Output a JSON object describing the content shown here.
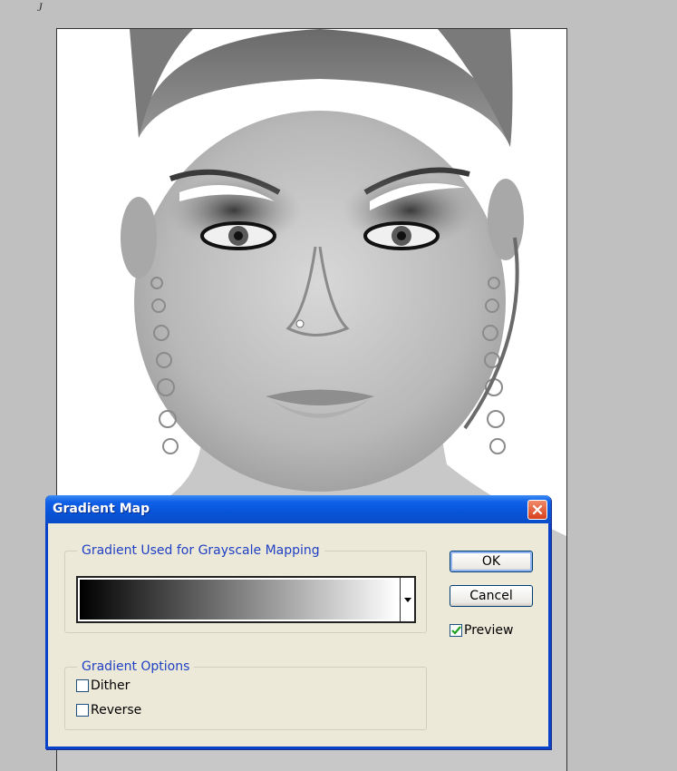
{
  "dialog": {
    "title": "Gradient Map",
    "mapping_group": {
      "legend": "Gradient Used for Grayscale Mapping"
    },
    "options_group": {
      "legend": "Gradient Options",
      "dither": {
        "label": "Dither",
        "checked": false
      },
      "reverse": {
        "label": "Reverse",
        "checked": false
      }
    },
    "ok_label": "OK",
    "cancel_label": "Cancel",
    "preview": {
      "label": "Preview",
      "checked": true
    }
  },
  "gradient": {
    "start_color": "#000000",
    "end_color": "#ffffff"
  },
  "colors": {
    "titlebar": "#0a54d8",
    "dialog_bg": "#ece9d8",
    "legend_text": "#1f3fc4",
    "close_button": "#e0532e",
    "workspace_bg": "#c0c0c0"
  },
  "icons": {
    "close": "close-x-icon",
    "dropdown": "triangle-down-icon",
    "check": "checkmark-icon"
  }
}
